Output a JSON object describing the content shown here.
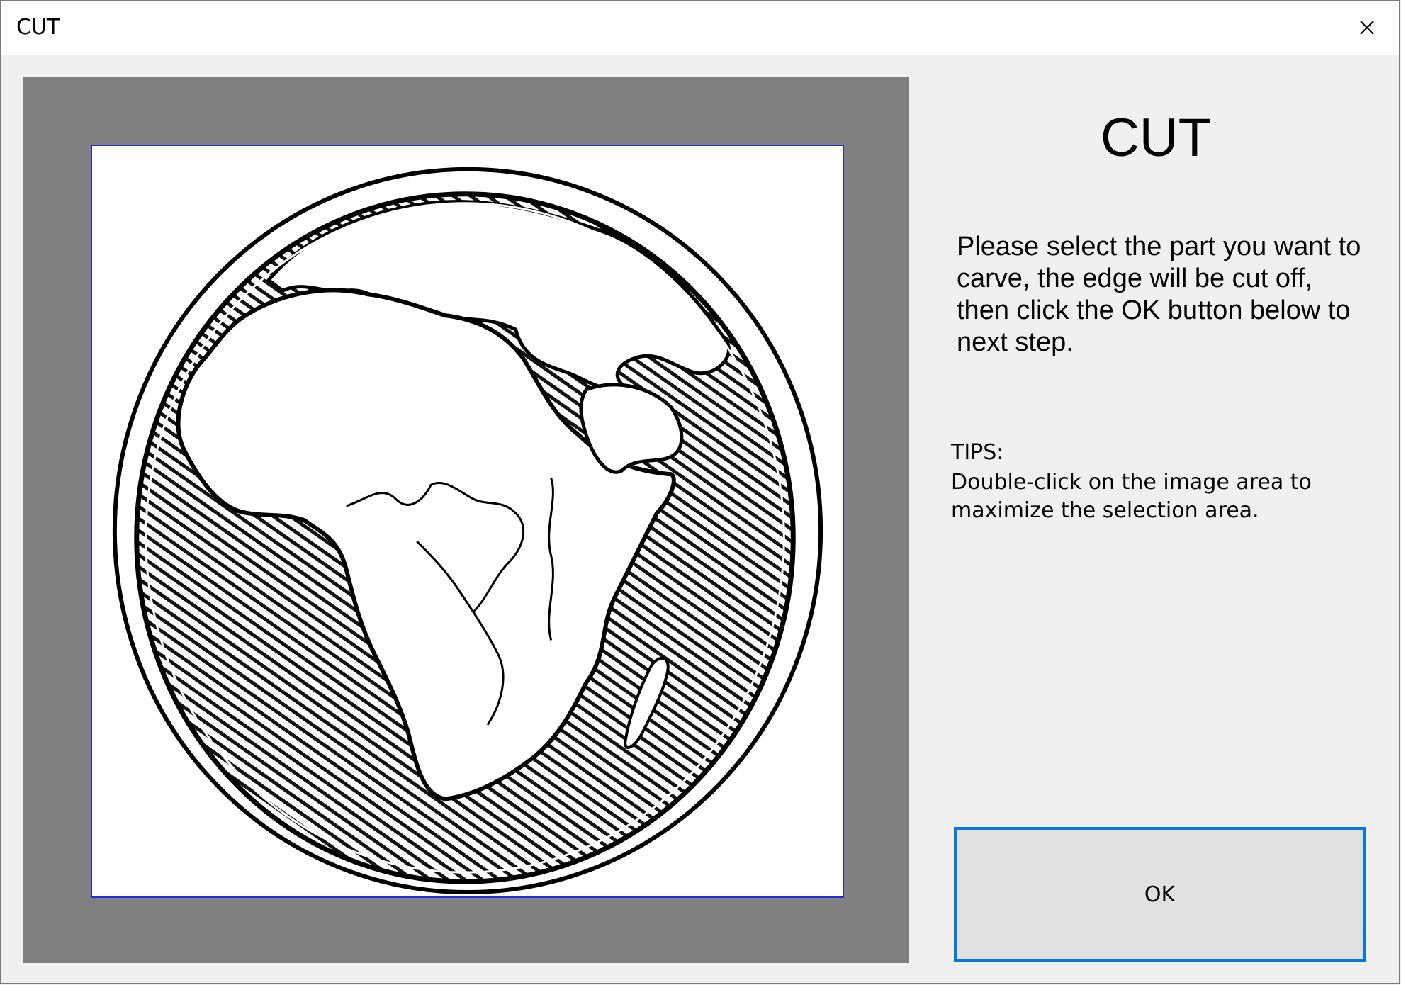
{
  "window": {
    "title": "CUT"
  },
  "titlebar": {
    "close_icon": "close-icon"
  },
  "canvas": {
    "image_subject": "hand-drawn globe illustration",
    "selection_color": "#1f2bd6",
    "background_color": "#808080"
  },
  "panel": {
    "heading": "CUT",
    "instructions": "Please select the part you want to carve, the edge will be cut off, then click the OK button below to next step.",
    "tips_label": "TIPS:",
    "tips_text": "Double-click on the image area to maximize the selection area."
  },
  "ok_button": {
    "label": "OK",
    "border_color": "#0a78d7"
  }
}
